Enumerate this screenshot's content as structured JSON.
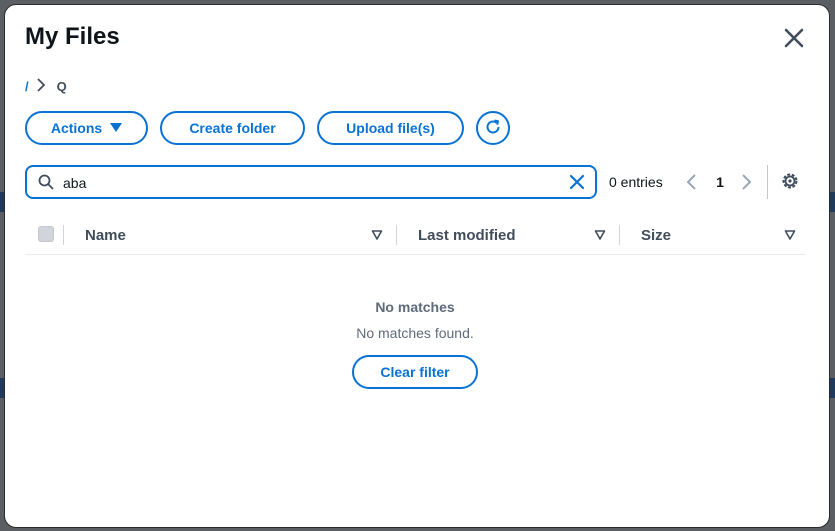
{
  "dialog": {
    "title": "My Files",
    "close_icon": "close-icon"
  },
  "breadcrumb": {
    "root": "/",
    "separator_icon": "chevron-right-icon",
    "current": "Q"
  },
  "toolbar": {
    "actions_label": "Actions",
    "create_folder_label": "Create folder",
    "upload_label": "Upload file(s)",
    "refresh_icon": "refresh-icon"
  },
  "filter": {
    "value": "aba",
    "placeholder": "",
    "search_icon": "search-icon",
    "clear_icon": "close-icon"
  },
  "pagination": {
    "entries_label": "0 entries",
    "current_page": "1",
    "prev_icon": "chevron-left-icon",
    "next_icon": "chevron-right-icon",
    "settings_icon": "gear-icon"
  },
  "table": {
    "columns": [
      {
        "label": "Name"
      },
      {
        "label": "Last modified"
      },
      {
        "label": "Size"
      }
    ],
    "rows": []
  },
  "empty_state": {
    "title": "No matches",
    "message": "No matches found.",
    "clear_filter_label": "Clear filter"
  },
  "colors": {
    "accent": "#0972d3",
    "text_primary": "#0f141a",
    "text_secondary": "#5f6b7a"
  }
}
